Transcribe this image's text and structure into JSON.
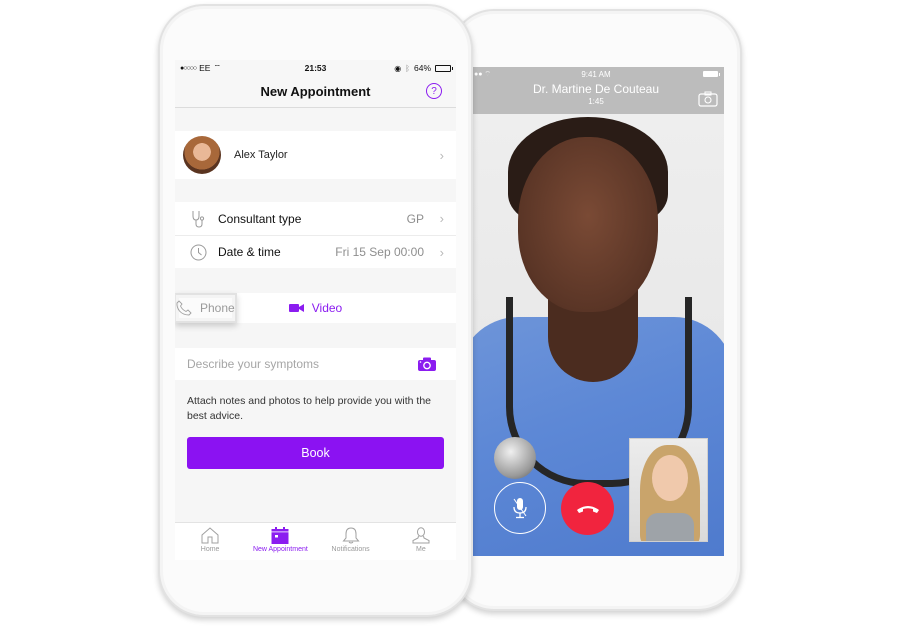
{
  "left_phone": {
    "status_bar": {
      "signal": "●○○○○",
      "carrier": "EE",
      "time": "21:53",
      "battery_percent": "64%",
      "battery_level": 0.64
    },
    "nav": {
      "title": "New Appointment",
      "help_icon": "?"
    },
    "profile": {
      "name": "Alex Taylor"
    },
    "settings": [
      {
        "icon": "stethoscope-icon",
        "label": "Consultant type",
        "value": "GP"
      },
      {
        "icon": "clock-icon",
        "label": "Date & time",
        "value": "Fri 15 Sep 00:00"
      }
    ],
    "modes": [
      {
        "icon": "video-camera-icon",
        "label": "Video",
        "active": true
      },
      {
        "icon": "phone-icon",
        "label": "Phone",
        "active": false
      }
    ],
    "symptoms": {
      "placeholder": "Describe your symptoms",
      "value": ""
    },
    "hint": "Attach notes and photos to help provide you with the best advice.",
    "book_label": "Book",
    "tabs": [
      {
        "icon": "home-icon",
        "label": "Home",
        "active": false
      },
      {
        "icon": "calendar-icon",
        "label": "New Appointment",
        "active": true
      },
      {
        "icon": "bell-icon",
        "label": "Notifications",
        "active": false
      },
      {
        "icon": "person-icon",
        "label": "Me",
        "active": false
      }
    ],
    "accent_color": "#8b12f2"
  },
  "right_phone": {
    "status_bar": {
      "time": "9:41 AM"
    },
    "call": {
      "doctor_name": "Dr. Martine De Couteau",
      "duration": "1:45"
    },
    "end_call_color": "#f1243e"
  }
}
